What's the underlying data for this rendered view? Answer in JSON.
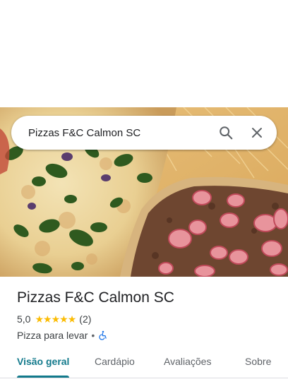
{
  "search": {
    "query": "Pizzas F&C Calmon SC",
    "search_icon": "search-icon",
    "close_icon": "close-icon"
  },
  "hero": {
    "image": "pizza-photo"
  },
  "place": {
    "name": "Pizzas F&C Calmon SC",
    "rating": "5,0",
    "rating_value": 5.0,
    "stars_icon": "star-icon",
    "review_count": "(2)",
    "category": "Pizza para levar",
    "separator": "•",
    "accessibility_icon": "wheelchair-icon"
  },
  "tabs": [
    {
      "label": "Visão geral",
      "active": true
    },
    {
      "label": "Cardápio",
      "active": false
    },
    {
      "label": "Avaliações",
      "active": false
    },
    {
      "label": "Sobre",
      "active": false
    }
  ],
  "colors": {
    "accent": "#137a8c",
    "star": "#fbbc04",
    "accessibility": "#1a73e8"
  }
}
